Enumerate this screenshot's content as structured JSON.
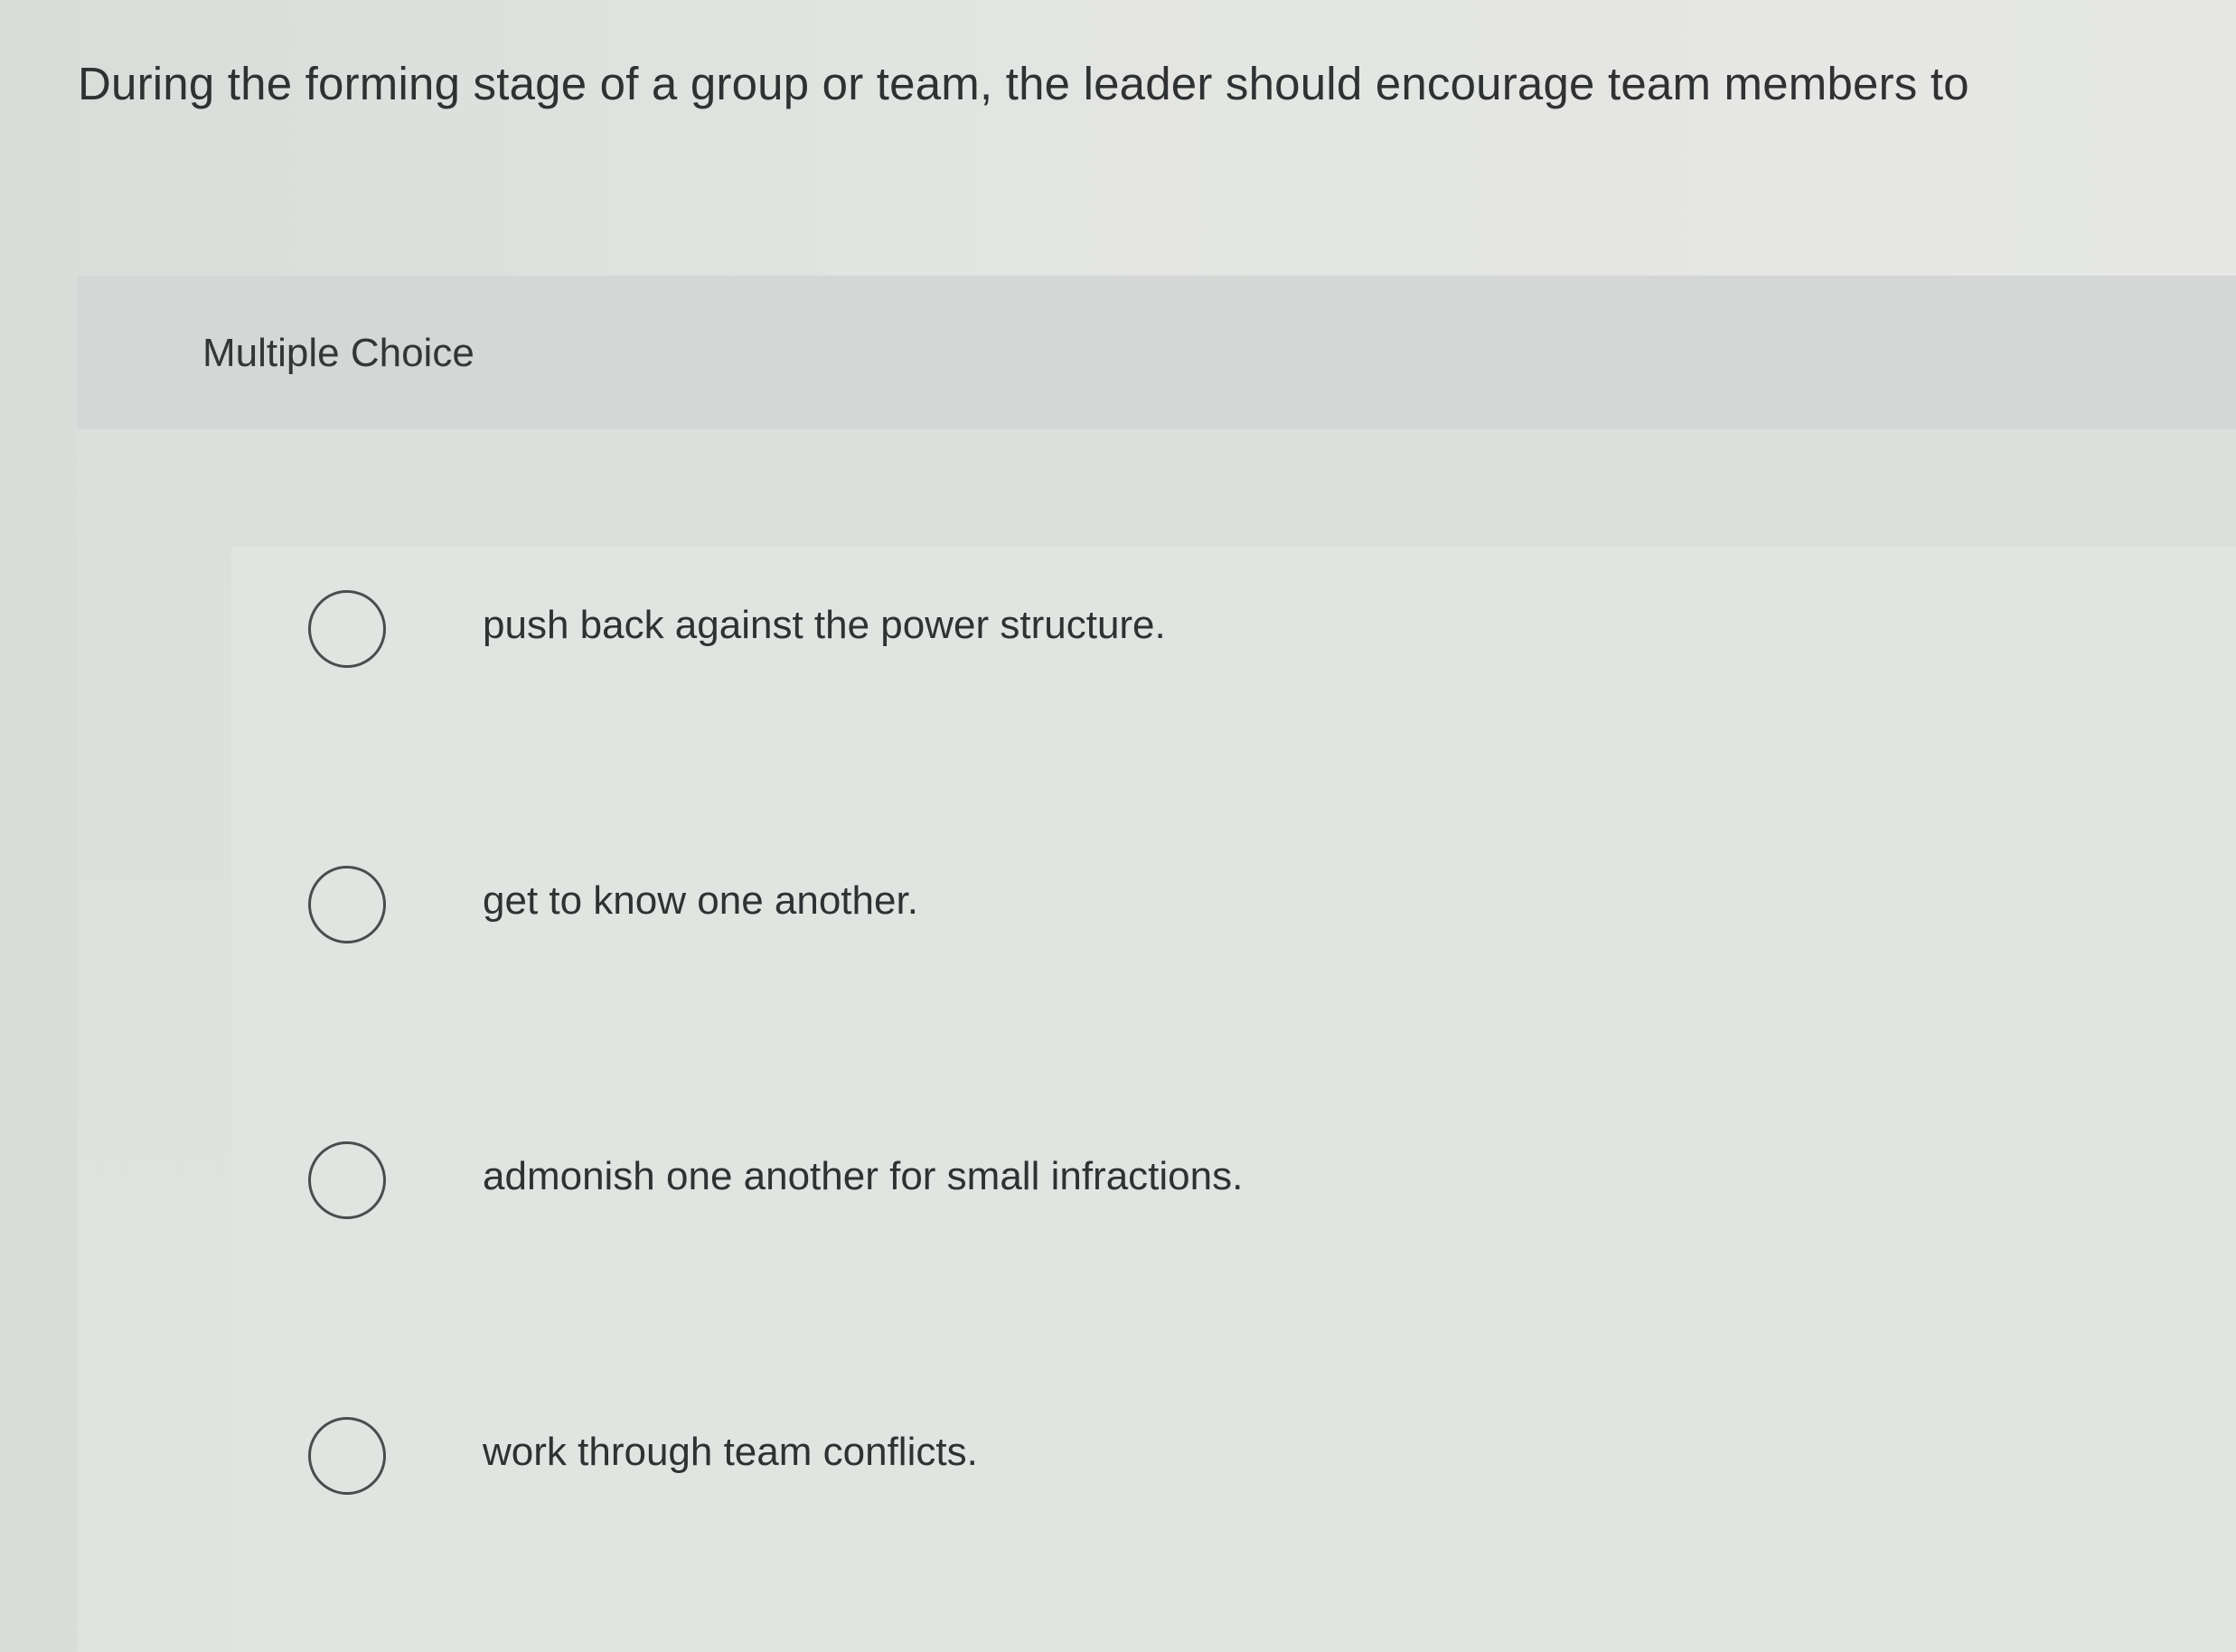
{
  "question": {
    "text": "During the forming stage of a group or team, the leader should encourage team members to"
  },
  "panel": {
    "type_label": "Multiple Choice"
  },
  "options": [
    {
      "label": "push back against the power structure.",
      "selected": false
    },
    {
      "label": "get to know one another.",
      "selected": false
    },
    {
      "label": "admonish one another for small infractions.",
      "selected": false
    },
    {
      "label": "work through team conflicts.",
      "selected": false
    }
  ]
}
